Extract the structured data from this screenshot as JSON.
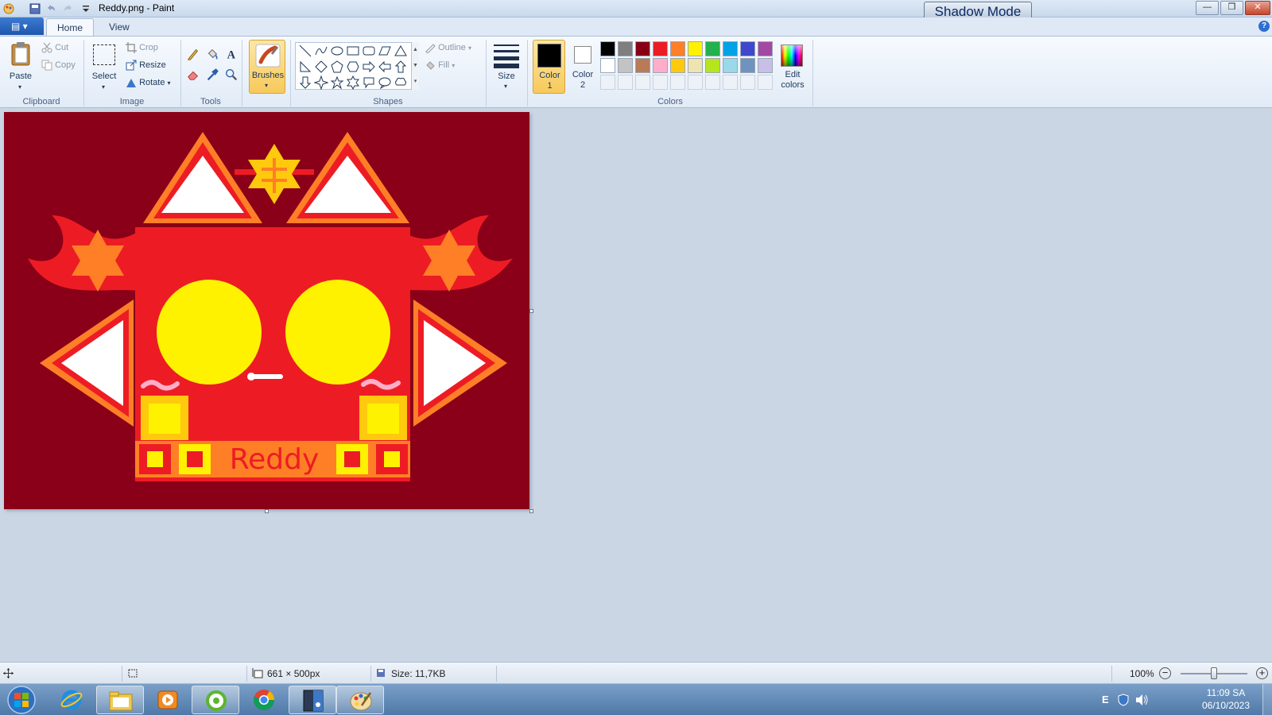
{
  "window": {
    "title": "Reddy.png - Paint",
    "shadow_mode_label": "Shadow Mode",
    "min_glyph": "—",
    "max_glyph": "❐",
    "close_glyph": "✕"
  },
  "tabs": {
    "file_glyph": "▤ ▾",
    "home": "Home",
    "view": "View",
    "help_glyph": "?"
  },
  "ribbon": {
    "clipboard": {
      "label": "Clipboard",
      "paste": "Paste",
      "cut": "Cut",
      "copy": "Copy"
    },
    "image": {
      "label": "Image",
      "select": "Select",
      "crop": "Crop",
      "resize": "Resize",
      "rotate": "Rotate"
    },
    "tools": {
      "label": "Tools"
    },
    "brushes": {
      "label": "Brushes"
    },
    "shapes": {
      "label": "Shapes",
      "outline": "Outline",
      "fill": "Fill"
    },
    "size": {
      "label": "Size"
    },
    "colors": {
      "label": "Colors",
      "color1_line1": "Color",
      "color1_line2": "1",
      "color2_line1": "Color",
      "color2_line2": "2",
      "edit_line1": "Edit",
      "edit_line2": "colors",
      "color1_value": "#000000",
      "color2_value": "#ffffff",
      "row1": [
        "#000000",
        "#7f7f7f",
        "#880015",
        "#ed1c24",
        "#ff7f27",
        "#fff200",
        "#22b14c",
        "#00a2e8",
        "#3f48cc",
        "#a349a4"
      ],
      "row2": [
        "#ffffff",
        "#c3c3c3",
        "#b97a57",
        "#ffaec9",
        "#ffc90e",
        "#efe4b0",
        "#b5e61d",
        "#99d9ea",
        "#7092be",
        "#c8bfe7"
      ]
    }
  },
  "canvas": {
    "artwork_text": "Reddy",
    "background": "#8a0018"
  },
  "status": {
    "dimensions": "661 × 500px",
    "size": "Size: 11,7KB",
    "zoom": "100%",
    "zoom_fraction": 0.5
  },
  "taskbar": {
    "tray_lang": "E",
    "time": "11:09 SA",
    "date": "06/10/2023"
  }
}
